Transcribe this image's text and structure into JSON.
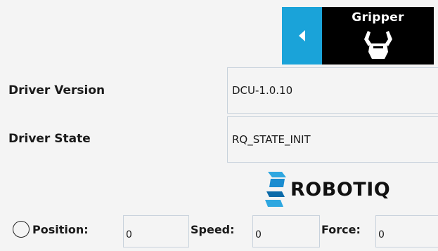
{
  "header": {
    "title": "Gripper",
    "back_icon": "chevron-left-icon",
    "gripper_icon": "gripper-icon",
    "colors": {
      "back_bg": "#1aa3d9",
      "title_bg": "#000000"
    }
  },
  "driver": {
    "version_label": "Driver Version",
    "version_value": "DCU-1.0.10",
    "state_label": "Driver State",
    "state_value": "RQ_STATE_INIT"
  },
  "brand": {
    "name": "ROBOTIQ",
    "colors": {
      "mark_light": "#2ea7e0",
      "mark_dark": "#0b6aa8"
    }
  },
  "controls": {
    "radio_icon": "radio-circle-icon",
    "position_label": "Position:",
    "position_value": "0",
    "speed_label": "Speed:",
    "speed_value": "0",
    "force_label": "Force:",
    "force_value": "0"
  }
}
